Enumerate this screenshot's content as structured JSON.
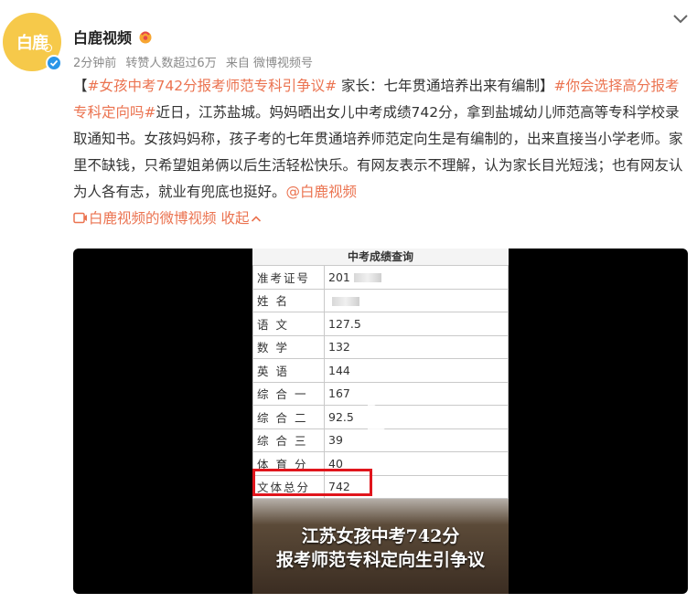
{
  "author": {
    "name": "白鹿视频",
    "avatar_text": "白鹿",
    "meta": {
      "time": "2分钟前",
      "reposts": "转赞人数超过6万",
      "source": "来自 微博视频号"
    }
  },
  "post": {
    "bracket_open": "【",
    "tag1": "#女孩中考742分报考师范专科引争议#",
    "quote": " 家长：七年贯通培养出来有编制",
    "bracket_close": "】",
    "tag2": "#你会选择高分报考专科定向吗#",
    "body": "近日，江苏盐城。妈妈晒出女儿中考成绩742分，拿到盐城幼儿师范高等专科学校录取通知书。女孩妈妈称，孩子考的七年贯通培养师范定向生是有编制的，出来直接当小学老师。家里不缺钱，只希望姐弟俩以后生活轻松快乐。有网友表示不理解，认为家长目光短浅；也有网友认为人各有志，就业有兜底也挺好。",
    "mention": "@白鹿视频",
    "video_link": "白鹿视频的微博视频",
    "collapse": "收起"
  },
  "video": {
    "sheet_title": "中考成绩查询",
    "rows": [
      {
        "label": "准考证号",
        "value": "201"
      },
      {
        "label": "姓名",
        "value": ""
      },
      {
        "label": "语文",
        "value": "127.5"
      },
      {
        "label": "数学",
        "value": "132"
      },
      {
        "label": "英语",
        "value": "144"
      },
      {
        "label": "综合一",
        "value": "167"
      },
      {
        "label": "综合二",
        "value": "92.5"
      },
      {
        "label": "综合三",
        "value": "39"
      },
      {
        "label": "体育分",
        "value": "40"
      },
      {
        "label": "文体总分",
        "value": "742"
      }
    ],
    "caption_line1": "江苏女孩中考742分",
    "caption_line2": "报考师范专科定向生引争议"
  },
  "colors": {
    "link": "#eb7350",
    "avatar_bg": "#f6c94a",
    "verify": "#2a96e8",
    "highlight": "#e0151c"
  }
}
